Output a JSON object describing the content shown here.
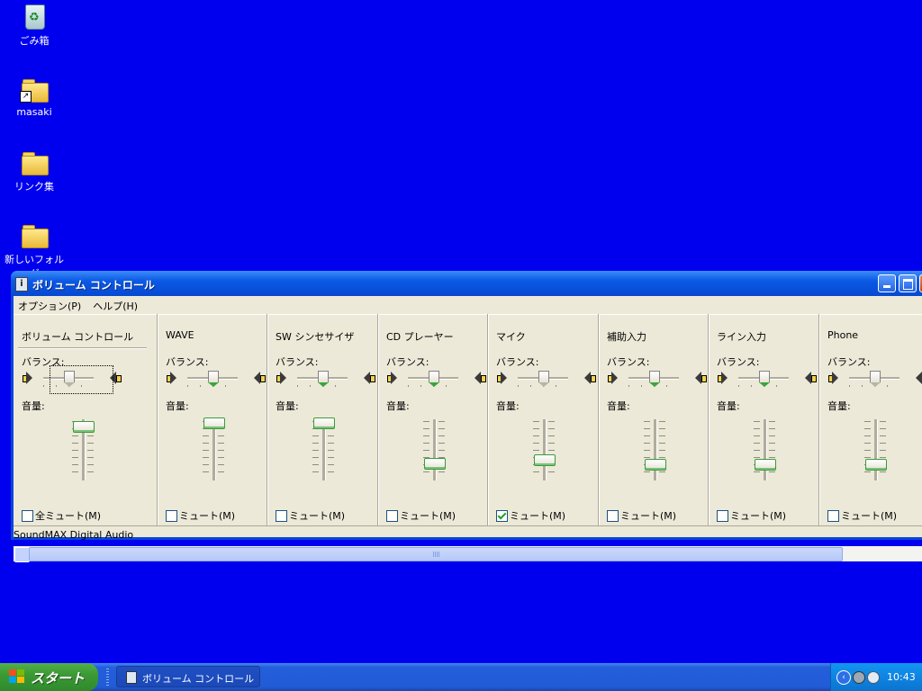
{
  "desktop": {
    "icons": [
      {
        "label": "ごみ箱",
        "icon": "recycle-bin-icon"
      },
      {
        "label": "masaki",
        "icon": "folder-shortcut-icon"
      },
      {
        "label": "リンク集",
        "icon": "folder-icon"
      },
      {
        "label": "新しいフォルダ",
        "icon": "folder-icon"
      }
    ]
  },
  "window": {
    "title": "ボリューム コントロール",
    "menu": [
      "オプション(P)",
      "ヘルプ(H)"
    ],
    "balance_label": "バランス:",
    "volume_label": "音量:",
    "channels": [
      {
        "name": "ボリューム コントロール",
        "mute_label": "全ミュート(M)",
        "muted": false,
        "balance": 0.5,
        "volume": 0.9,
        "balance_active": false
      },
      {
        "name": "WAVE",
        "mute_label": "ミュート(M)",
        "muted": false,
        "balance": 0.5,
        "volume": 0.95,
        "balance_active": true
      },
      {
        "name": "SW シンセサイザ",
        "mute_label": "ミュート(M)",
        "muted": false,
        "balance": 0.5,
        "volume": 0.95,
        "balance_active": true
      },
      {
        "name": "CD プレーヤー",
        "mute_label": "ミュート(M)",
        "muted": false,
        "balance": 0.5,
        "volume": 0.3,
        "balance_active": true
      },
      {
        "name": "マイク",
        "mute_label": "ミュート(M)",
        "muted": true,
        "balance": 0.5,
        "volume": 0.35,
        "balance_active": false
      },
      {
        "name": "補助入力",
        "mute_label": "ミュート(M)",
        "muted": false,
        "balance": 0.5,
        "volume": 0.28,
        "balance_active": true
      },
      {
        "name": "ライン入力",
        "mute_label": "ミュート(M)",
        "muted": false,
        "balance": 0.5,
        "volume": 0.28,
        "balance_active": true
      },
      {
        "name": "Phone",
        "mute_label": "ミュート(M)",
        "muted": false,
        "balance": 0.5,
        "volume": 0.28,
        "balance_active": false
      }
    ],
    "status_text": "SoundMAX Digital Audio"
  },
  "taskbar": {
    "start_label": "スタート",
    "task_label": "ボリューム コントロール",
    "clock": "10:43",
    "tray_expand": "‹"
  }
}
